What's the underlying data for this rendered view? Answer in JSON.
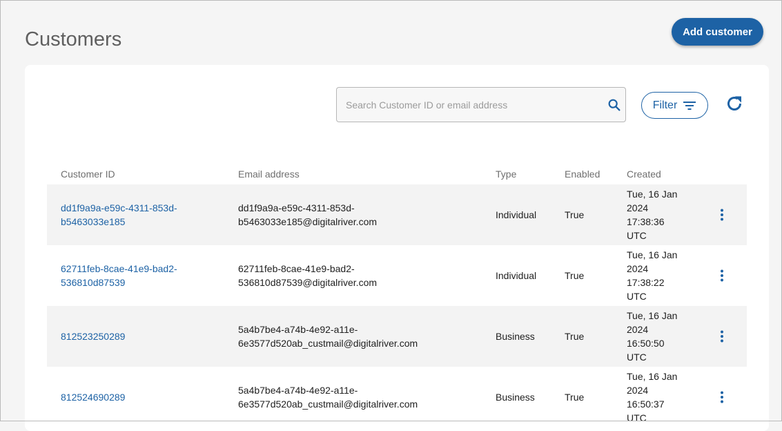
{
  "header": {
    "title": "Customers",
    "add_button_label": "Add customer"
  },
  "toolbar": {
    "search_placeholder": "Search Customer ID or email address",
    "filter_label": "Filter"
  },
  "table": {
    "columns": [
      "Customer ID",
      "Email address",
      "Type",
      "Enabled",
      "Created"
    ],
    "rows": [
      {
        "id_lines": [
          "dd1f9a9a-e59c-4311-853d-",
          "b5463033e185"
        ],
        "email_lines": [
          "dd1f9a9a-e59c-4311-853d-",
          "b5463033e185@digitalriver.com"
        ],
        "type": "Individual",
        "enabled": "True",
        "created_lines": [
          "Tue, 16 Jan",
          "2024",
          "17:38:36",
          "UTC"
        ]
      },
      {
        "id_lines": [
          "62711feb-8cae-41e9-bad2-",
          "536810d87539"
        ],
        "email_lines": [
          "62711feb-8cae-41e9-bad2-",
          "536810d87539@digitalriver.com"
        ],
        "type": "Individual",
        "enabled": "True",
        "created_lines": [
          "Tue, 16 Jan",
          "2024",
          "17:38:22",
          "UTC"
        ]
      },
      {
        "id_lines": [
          "812523250289"
        ],
        "email_lines": [
          "5a4b7be4-a74b-4e92-a11e-",
          "6e3577d520ab_custmail@digitalriver.com"
        ],
        "type": "Business",
        "enabled": "True",
        "created_lines": [
          "Tue, 16 Jan",
          "2024",
          "16:50:50",
          "UTC"
        ]
      },
      {
        "id_lines": [
          "812524690289"
        ],
        "email_lines": [
          "5a4b7be4-a74b-4e92-a11e-",
          "6e3577d520ab_custmail@digitalriver.com"
        ],
        "type": "Business",
        "enabled": "True",
        "created_lines": [
          "Tue, 16 Jan",
          "2024",
          "16:50:37",
          "UTC"
        ]
      }
    ]
  },
  "colors": {
    "accent": "#1d62a5",
    "row_alt": "#f3f3f3",
    "background": "#f5f5f5"
  },
  "icons": {
    "search": "search-icon",
    "filter": "filter-icon",
    "refresh": "refresh-icon",
    "row_menu": "more-vertical-icon"
  }
}
